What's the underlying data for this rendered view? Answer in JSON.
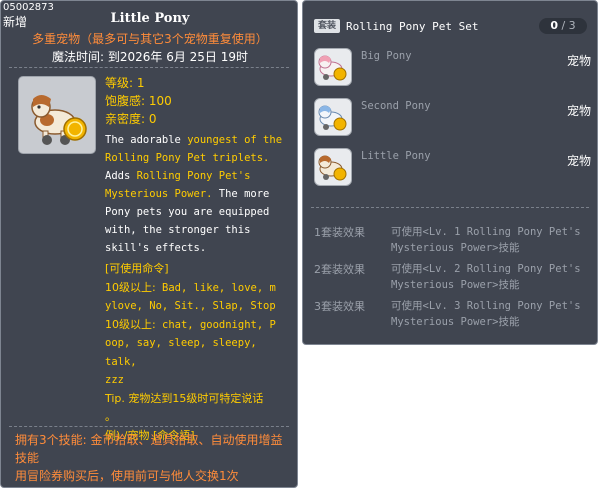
{
  "item": {
    "id": "05002873",
    "new_tag": "新增",
    "name": "Little Pony",
    "subtitle": "多重宠物（最多可与其它3个宠物重复使用）",
    "expiry": "魔法时间: 到2026年 6月 25日 19时",
    "stats": {
      "level": "等级: 1",
      "fullness": "饱腹感: 100",
      "closeness": "亲密度: 0"
    },
    "description": [
      {
        "t": "The adorable ",
        "hl": false
      },
      {
        "t": "youngest of the",
        "hl": true
      },
      {
        "t": "Rolling Pony Pet triplets.",
        "hl": true
      },
      {
        "t": "Adds ",
        "hl": false
      },
      {
        "t": "Rolling Pony Pet's",
        "hl": true
      },
      {
        "t": "Mysterious Power.",
        "hl": true
      },
      {
        "t": " The more",
        "hl": false
      },
      {
        "t": "Pony pets you are equipped",
        "hl": false
      },
      {
        "t": "with, the stronger this",
        "hl": false
      },
      {
        "t": "skill's effects.",
        "hl": false
      }
    ],
    "commands": {
      "header": "[可使用命令]",
      "lv1_label": "10级以上:",
      "lv1_cmds": " Bad, like, love, m",
      "lv1_cmds2": "ylove, No, Sit., Slap, Stop",
      "lv10_label": "10级以上:",
      "lv10_cmds": " chat, goodnight, P",
      "lv10_cmds2": "oop, say, sleep, sleepy, talk,",
      "lv10_cmds3": "zzz",
      "tip": "Tip. 宠物达到15级时可特定说话",
      "tip2": "。",
      "example": "例) /宠物 [命令語]"
    },
    "skills_line1": "拥有3个技能: 金币拾取、道具拾取、自动使用增益",
    "skills_line2": "技能",
    "trade_note": "用冒险券购买后，使用前可与他人交换1次"
  },
  "set": {
    "badge": "套装",
    "title": "Rolling Pony Pet Set",
    "owned": "0",
    "separator": " / ",
    "total": "3",
    "items": [
      {
        "name": "Big Pony",
        "type": "宠物",
        "color": "#f0a0b4"
      },
      {
        "name": "Second Pony",
        "type": "宠物",
        "color": "#8ab6e6"
      },
      {
        "name": "Little Pony",
        "type": "宠物",
        "color": "#d9a070"
      }
    ],
    "effects": [
      {
        "label": "1套装效果",
        "text": "可使用<Lv. 1 Rolling Pony Pet's Mysterious Power>技能"
      },
      {
        "label": "2套装效果",
        "text": "可使用<Lv. 2 Rolling Pony Pet's Mysterious Power>技能"
      },
      {
        "label": "3套装效果",
        "text": "可使用<Lv. 3 Rolling Pony Pet's Mysterious Power>技能"
      }
    ]
  },
  "colors": {
    "panel_bg": "#404550",
    "highlight_yellow": "#ffcc00",
    "orange": "#ff8c3a",
    "muted_gray": "#9aa0aa"
  }
}
